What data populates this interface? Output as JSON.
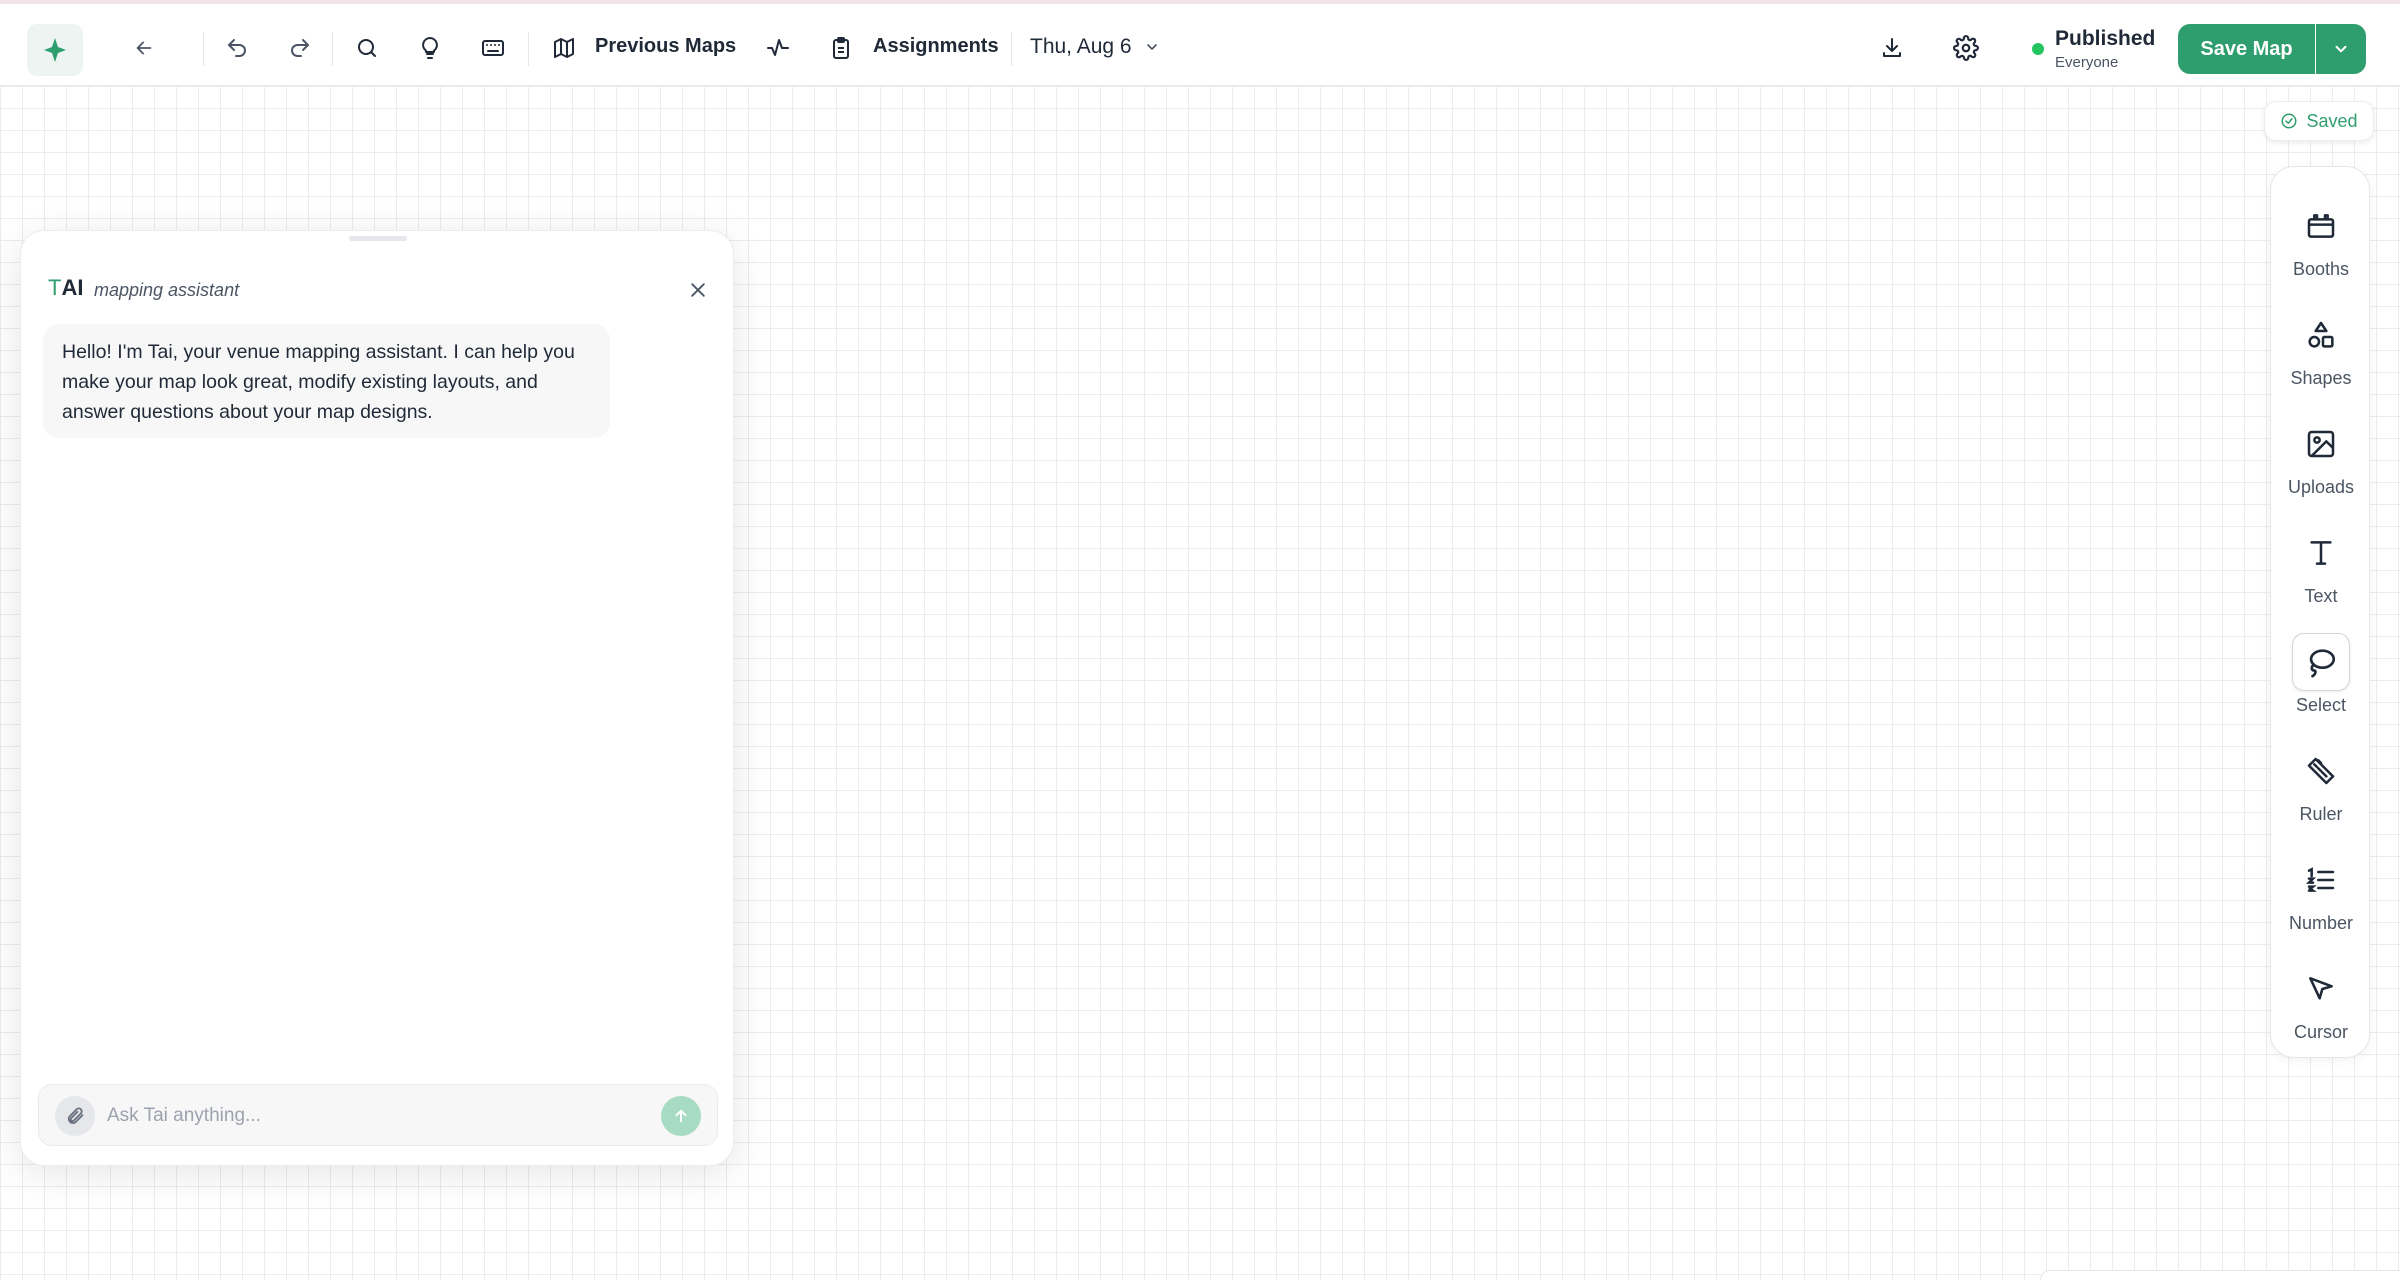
{
  "topbar": {
    "previous_maps_label": "Previous Maps",
    "assignments_label": "Assignments",
    "date_label": "Thu, Aug 6",
    "publish_status": "Published",
    "publish_audience": "Everyone",
    "save_label": "Save Map",
    "status_color": "#22c55e",
    "brand_color": "#2f9e6f"
  },
  "saved_indicator": {
    "label": "Saved"
  },
  "toolbar": {
    "items": [
      {
        "label": "Booths",
        "icon": "booth-icon"
      },
      {
        "label": "Shapes",
        "icon": "shapes-icon"
      },
      {
        "label": "Uploads",
        "icon": "image-icon"
      },
      {
        "label": "Text",
        "icon": "text-icon"
      },
      {
        "label": "Select",
        "icon": "lasso-icon",
        "active": true
      },
      {
        "label": "Ruler",
        "icon": "ruler-icon"
      },
      {
        "label": "Number",
        "icon": "numbered-list-icon"
      },
      {
        "label": "Cursor",
        "icon": "cursor-icon"
      }
    ]
  },
  "chat": {
    "title_prefix": "T",
    "title_rest": "AI",
    "subtitle": "mapping assistant",
    "messages": [
      {
        "role": "assistant",
        "text": "Hello! I'm Tai, your venue mapping assistant. I can help you make your map look great, modify existing layouts, and answer questions about your map designs."
      }
    ],
    "input_value": "",
    "input_placeholder": "Ask Tai anything..."
  }
}
